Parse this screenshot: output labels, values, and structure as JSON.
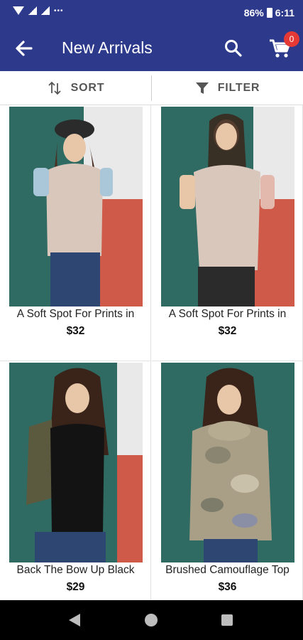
{
  "status_bar": {
    "battery": "86%",
    "time": "6:11"
  },
  "app_bar": {
    "title": "New Arrivals",
    "back_icon": "arrow-back-icon",
    "search_icon": "search-icon",
    "cart_icon": "cart-icon",
    "cart_count": "0",
    "background": "#2d3a8c",
    "badge_color": "#e53935"
  },
  "toolbar": {
    "sort_label": "SORT",
    "filter_label": "FILTER"
  },
  "products": [
    {
      "name": "A Soft Spot For Prints in",
      "price": "$32"
    },
    {
      "name": "A Soft Spot For Prints in",
      "price": "$32"
    },
    {
      "name": "Back The Bow Up Black",
      "price": "$29"
    },
    {
      "name": "Brushed Camouflage Top",
      "price": "$36"
    }
  ]
}
